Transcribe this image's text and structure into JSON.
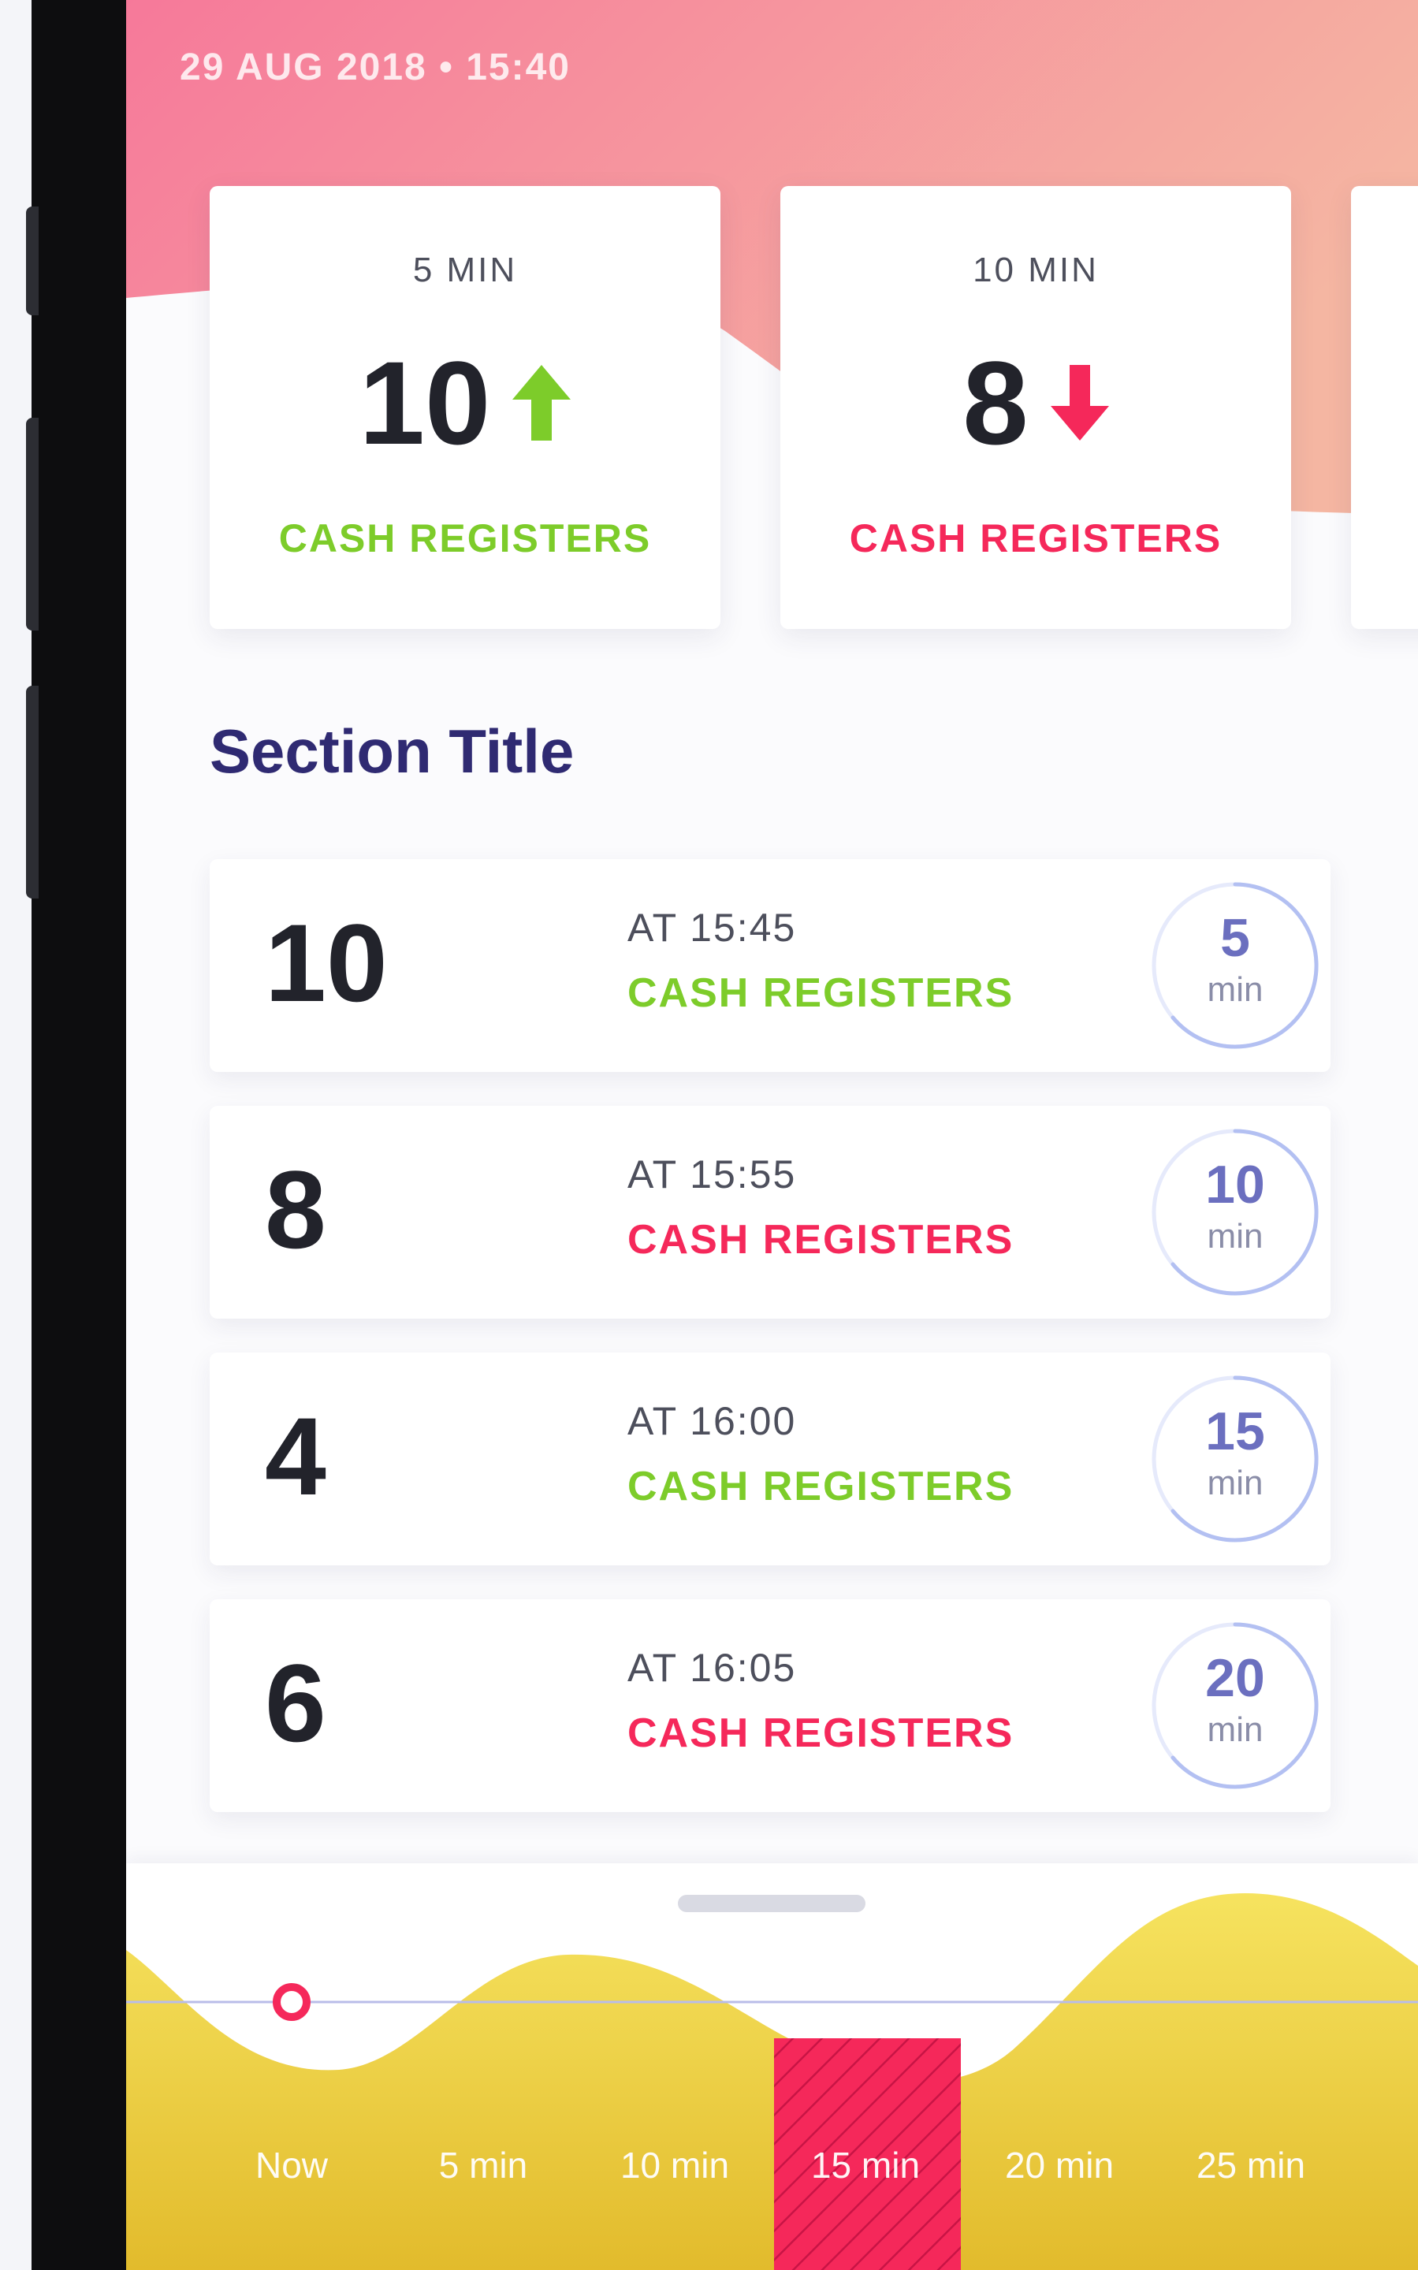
{
  "header": {
    "datetime": "29 AUG 2018 • 15:40"
  },
  "summary_cards": [
    {
      "interval": "5 MIN",
      "count": "10",
      "trend": "up",
      "label": "CASH REGISTERS",
      "color": "#7dcc2a"
    },
    {
      "interval": "10 MIN",
      "count": "8",
      "trend": "down",
      "label": "CASH REGISTERS",
      "color": "#f5285a"
    }
  ],
  "section": {
    "title": "Section Title"
  },
  "rows": [
    {
      "count": "10",
      "time": "AT 15:45",
      "label": "CASH REGISTERS",
      "status": "green",
      "minutes": "5",
      "unit": "min"
    },
    {
      "count": "8",
      "time": "AT 15:55",
      "label": "CASH REGISTERS",
      "status": "red",
      "minutes": "10",
      "unit": "min"
    },
    {
      "count": "4",
      "time": "AT 16:00",
      "label": "CASH REGISTERS",
      "status": "green",
      "minutes": "15",
      "unit": "min"
    },
    {
      "count": "6",
      "time": "AT 16:05",
      "label": "CASH REGISTERS",
      "status": "red",
      "minutes": "20",
      "unit": "min"
    }
  ],
  "timeline": {
    "labels": [
      "Now",
      "5 min",
      "10 min",
      "15 min",
      "20 min",
      "25 min"
    ],
    "selected_index": 3
  },
  "colors": {
    "header_gradient_start": "#f6799a",
    "header_gradient_end": "#f5b6a2",
    "green": "#7dcc2a",
    "red": "#f5285a",
    "title": "#2f2a72",
    "ring": "#b3c0f2",
    "chart_yellow": "#f3de58",
    "chart_yellow_dark": "#e3bd2d"
  }
}
